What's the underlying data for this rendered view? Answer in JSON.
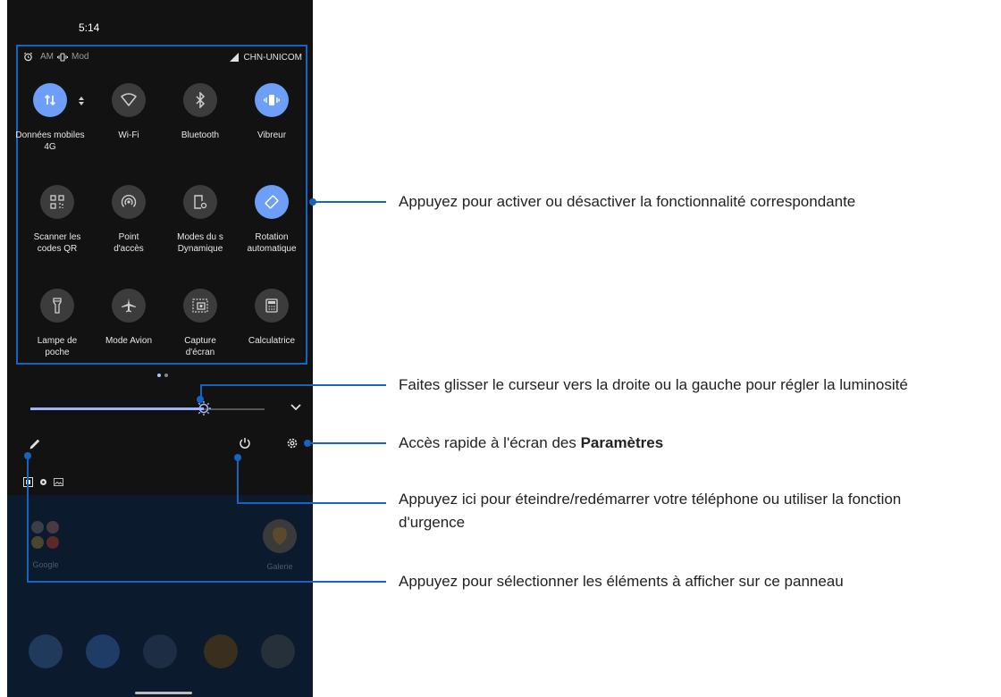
{
  "status_bar": {
    "time": "5:14",
    "alarm_text": "AM",
    "vibrate_text": "Mod",
    "carrier": "CHN-UNICOM"
  },
  "quick_settings": {
    "tiles": [
      {
        "label": "Données mobiles\n4G",
        "icon": "mobile-data-icon",
        "state": "on"
      },
      {
        "label": "Wi-Fi",
        "icon": "wifi-icon",
        "state": "off"
      },
      {
        "label": "Bluetooth",
        "icon": "bluetooth-icon",
        "state": "off"
      },
      {
        "label": "Vibreur",
        "icon": "vibrate-icon",
        "state": "on"
      },
      {
        "label": "Scanner les\ncodes QR",
        "icon": "qr-code-icon",
        "state": "off"
      },
      {
        "label": "Point\nd'accès",
        "icon": "hotspot-icon",
        "state": "off"
      },
      {
        "label": "Modes du s\nDynamique",
        "icon": "display-mode-icon",
        "state": "off"
      },
      {
        "label": "Rotation\nautomatique",
        "icon": "auto-rotate-icon",
        "state": "on"
      },
      {
        "label": "Lampe de\npoche",
        "icon": "flashlight-icon",
        "state": "off"
      },
      {
        "label": "Mode Avion",
        "icon": "airplane-icon",
        "state": "off"
      },
      {
        "label": "Capture\nd'écran",
        "icon": "screenshot-icon",
        "state": "off"
      },
      {
        "label": "Calculatrice",
        "icon": "calculator-icon",
        "state": "off"
      }
    ]
  },
  "brightness": {
    "level": 0.74
  },
  "home": {
    "apps": [
      {
        "label": "Google"
      },
      {
        "label": "Galerie"
      }
    ]
  },
  "annotations": {
    "tiles": "Appuyez pour activer ou désactiver la fonctionnalité correspondante",
    "brightness": "Faites glisser le curseur vers la droite ou la gauche pour régler la luminosité",
    "settings_prefix": "Accès rapide à l'écran des ",
    "settings_bold": "Paramètres",
    "power_line1": "Appuyez ici pour éteindre/redémarrer votre téléphone ou utiliser la fonction",
    "power_line2": "d'urgence",
    "edit": "Appuyez pour sélectionner les éléments à afficher sur ce panneau"
  },
  "colors": {
    "accent": "#1565c0",
    "tile_on": "#6d9ef8",
    "tile_off": "#3c3c3c",
    "panel_bg": "#121212"
  }
}
